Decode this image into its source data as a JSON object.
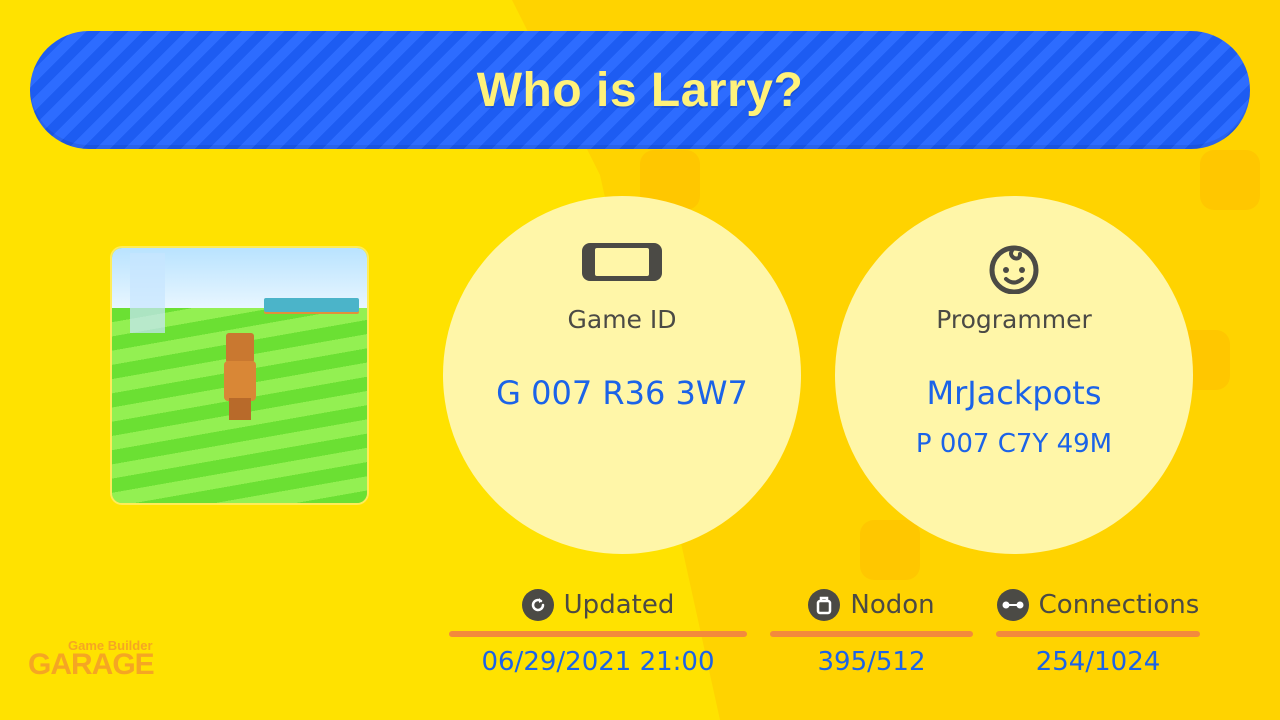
{
  "title": "Who is Larry?",
  "thumbnail": {
    "alt_icon": "game-screenshot"
  },
  "game_id": {
    "icon": "switch-console-icon",
    "label": "Game ID",
    "value": "G 007 R36 3W7"
  },
  "programmer": {
    "icon": "face-icon",
    "label": "Programmer",
    "name": "MrJackpots",
    "id": "P 007 C7Y 49M"
  },
  "stats": {
    "updated": {
      "icon": "refresh-icon",
      "label": "Updated",
      "value": "06/29/2021 21:00"
    },
    "nodon": {
      "icon": "nodon-icon",
      "label": "Nodon",
      "value": "395/512"
    },
    "connections": {
      "icon": "connection-icon",
      "label": "Connections",
      "value": "254/1024"
    }
  },
  "logo": {
    "line1": "Game Builder",
    "line2": "GARAGE"
  },
  "colors": {
    "background": "#ffe200",
    "banner": "#1d5cf2",
    "title_text": "#fff27a",
    "circle": "#fff6a8",
    "value_text": "#1b63e8",
    "label_text": "#4b4a45",
    "accent_bar": "#f38a3c"
  }
}
